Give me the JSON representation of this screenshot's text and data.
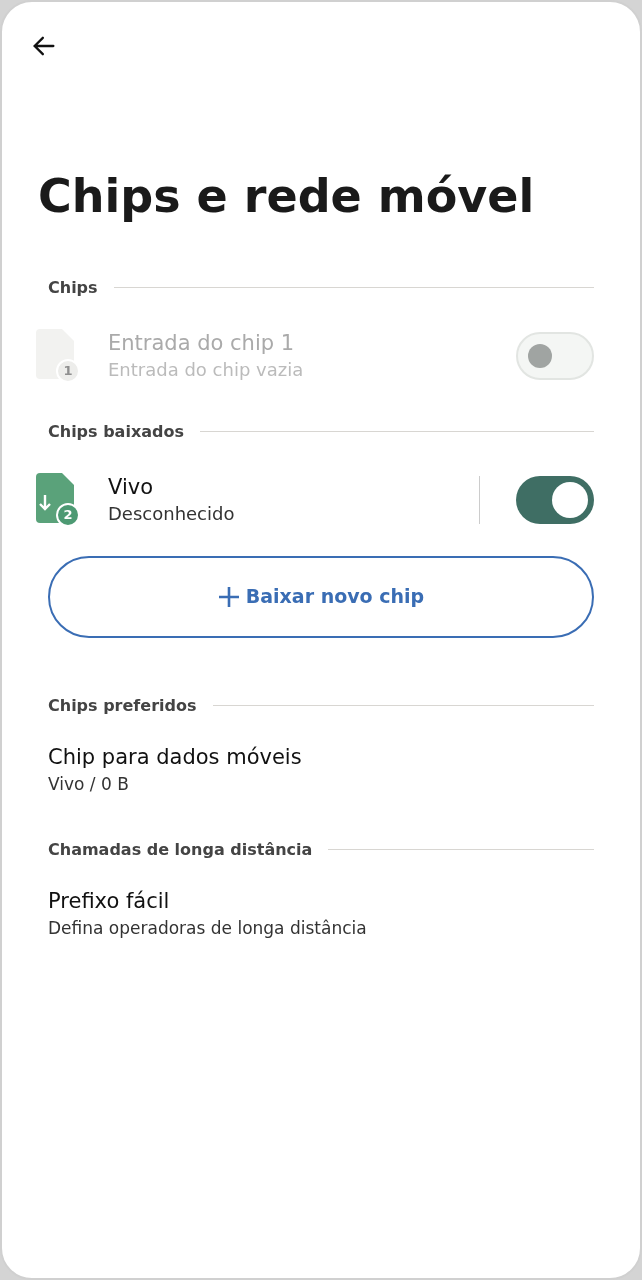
{
  "title": "Chips e rede móvel",
  "sections": [
    {
      "header": "Chips",
      "items": [
        {
          "kind": "sim",
          "title": "Entrada do chip 1",
          "subtitle": "Entrada do chip vazia",
          "badge": "1",
          "disabled": true,
          "downloaded": false,
          "on": false
        }
      ]
    },
    {
      "header": "Chips baixados",
      "items": [
        {
          "kind": "sim",
          "title": "Vivo",
          "subtitle": "Desconhecido",
          "badge": "2",
          "disabled": false,
          "downloaded": true,
          "on": true
        },
        {
          "kind": "button",
          "label": "Baixar novo chip"
        }
      ]
    },
    {
      "header": "Chips preferidos",
      "items": [
        {
          "kind": "setting",
          "title": "Chip para dados móveis",
          "subtitle": "Vivo / 0 B"
        }
      ]
    },
    {
      "header": "Chamadas de longa distância",
      "items": [
        {
          "kind": "setting",
          "title": "Prefixo fácil",
          "subtitle": "Defina operadoras de longa distância"
        }
      ]
    }
  ]
}
